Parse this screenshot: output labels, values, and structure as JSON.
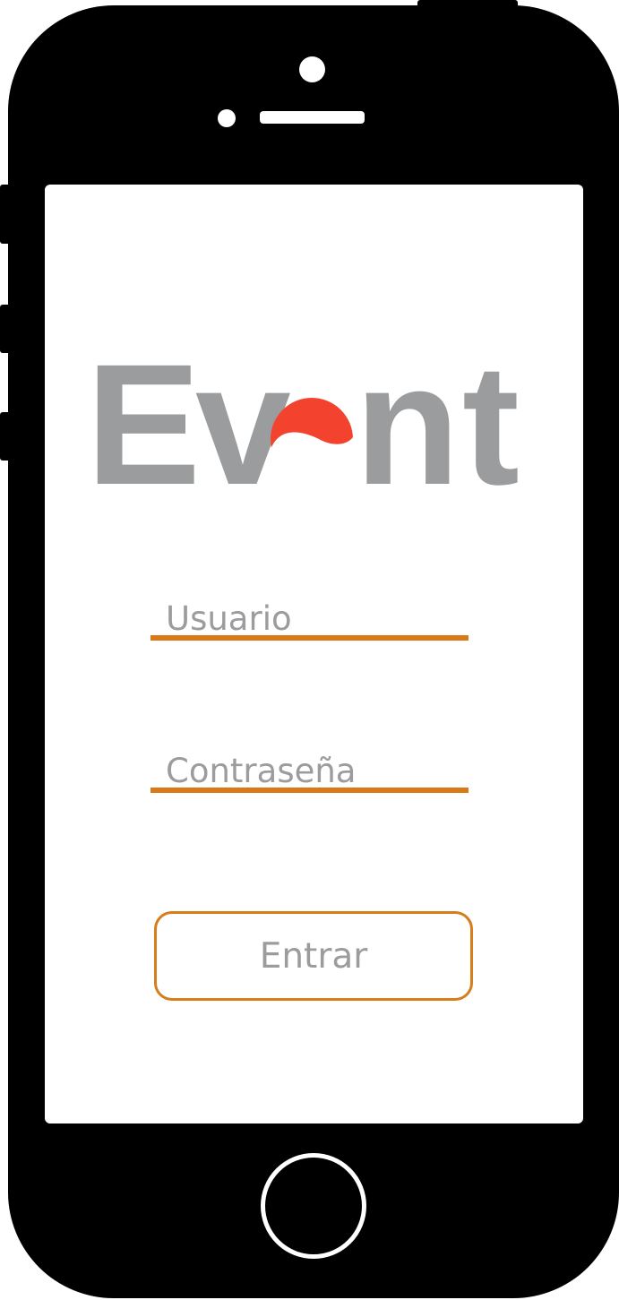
{
  "logo": {
    "letter_1": "E",
    "letter_2": "v",
    "letter_3": "e",
    "letter_4": "n",
    "letter_5": "t",
    "text_color": "#9b9c9e",
    "accent_color": "#f3432e"
  },
  "login": {
    "username_placeholder": "Usuario",
    "password_placeholder": "Contraseña",
    "underline_color": "#d97a17",
    "submit_label": "Entrar",
    "submit_border_color": "#d67d1e"
  },
  "device": {
    "type": "phone-frame",
    "frame_color": "#000000",
    "screen_color": "#ffffff"
  }
}
